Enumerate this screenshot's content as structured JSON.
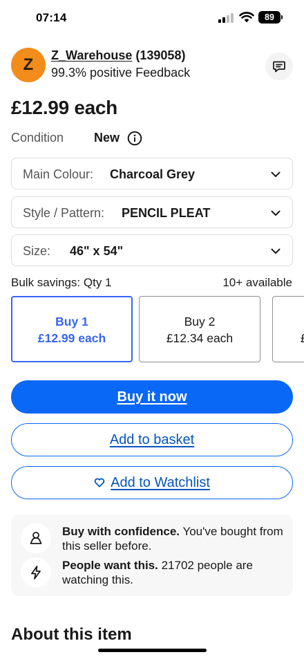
{
  "status_bar": {
    "time": "07:14",
    "battery": "89"
  },
  "seller": {
    "avatar_letter": "Z",
    "name": "Z_Warehouse",
    "feedback_count": "(139058)",
    "feedback": "99.3% positive Feedback",
    "message_icon": "chat-icon"
  },
  "price": "£12.99 each",
  "condition": {
    "label": "Condition",
    "value": "New",
    "icon": "info-icon"
  },
  "selects": [
    {
      "label": "Main Colour:",
      "value": "Charcoal Grey"
    },
    {
      "label": "Style / Pattern:",
      "value": "PENCIL PLEAT"
    },
    {
      "label": "Size:",
      "value": "46\" x 54\""
    }
  ],
  "bulk": {
    "label": "Bulk savings: Qty 1",
    "available": "10+ available",
    "tiers": [
      {
        "qty": "Buy 1",
        "price": "£12.99 each",
        "selected": true
      },
      {
        "qty": "Buy 2",
        "price": "£12.34 each",
        "selected": false
      },
      {
        "qty": "",
        "price": "£",
        "selected": false
      }
    ]
  },
  "actions": {
    "buy_now": "Buy it now",
    "add_to_basket": "Add to basket",
    "add_to_watchlist": "Add to Watchlist"
  },
  "confidence": [
    {
      "icon": "person-icon",
      "bold": "Buy with confidence.",
      "text": " You've bought from this seller before."
    },
    {
      "icon": "lightning-icon",
      "bold": "People want this.",
      "text": " 21702 people are watching this."
    }
  ],
  "about_heading": "About this item",
  "colors": {
    "primary": "#0968f6",
    "link": "#0654ba",
    "selected_tier": "#3665f3",
    "avatar": "#f28c1a"
  }
}
